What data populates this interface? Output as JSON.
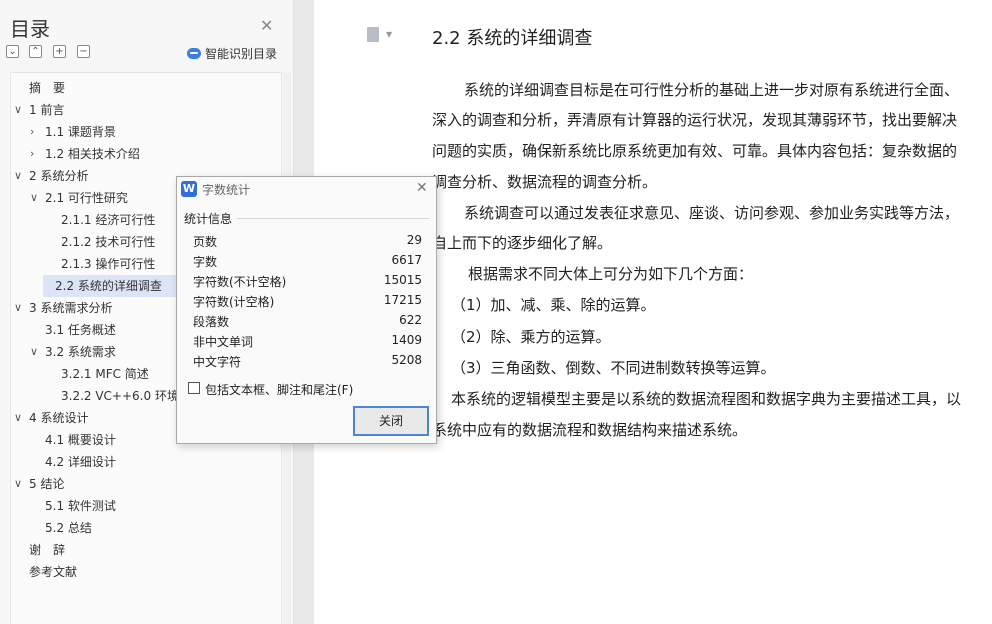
{
  "sidebar": {
    "title": "目录",
    "smart_toc_label": "智能识别目录",
    "tools": [
      "expand-all",
      "collapse",
      "add",
      "remove"
    ],
    "items": [
      {
        "label": "摘　要",
        "level": 0,
        "chevron": ""
      },
      {
        "label": "1 前言",
        "level": 0,
        "chevron": "v"
      },
      {
        "label": "1.1 课题背景",
        "level": 1,
        "chevron": ">"
      },
      {
        "label": "1.2 相关技术介绍",
        "level": 1,
        "chevron": ">"
      },
      {
        "label": "2 系统分析",
        "level": 0,
        "chevron": "v"
      },
      {
        "label": "2.1 可行性研究",
        "level": 1,
        "chevron": "v"
      },
      {
        "label": "2.1.1 经济可行性",
        "level": 2,
        "chevron": ""
      },
      {
        "label": "2.1.2 技术可行性",
        "level": 2,
        "chevron": ""
      },
      {
        "label": "2.1.3 操作可行性",
        "level": 2,
        "chevron": ""
      },
      {
        "label": "2.2 系统的详细调查",
        "level": 1,
        "chevron": "",
        "selected": true
      },
      {
        "label": "3 系统需求分析",
        "level": 0,
        "chevron": "v"
      },
      {
        "label": "3.1  任务概述",
        "level": 1,
        "chevron": ""
      },
      {
        "label": "3.2  系统需求",
        "level": 1,
        "chevron": "v"
      },
      {
        "label": "3.2.1 MFC 简述",
        "level": 2,
        "chevron": ""
      },
      {
        "label": "3.2.2   VC++6.0 环境",
        "level": 2,
        "chevron": ""
      },
      {
        "label": "4 系统设计",
        "level": 0,
        "chevron": "v"
      },
      {
        "label": "4.1  概要设计",
        "level": 1,
        "chevron": ""
      },
      {
        "label": "4.2 详细设计",
        "level": 1,
        "chevron": ""
      },
      {
        "label": "5 结论",
        "level": 0,
        "chevron": "v"
      },
      {
        "label": "5.1 软件测试",
        "level": 1,
        "chevron": ""
      },
      {
        "label": "5.2 总结",
        "level": 1,
        "chevron": ""
      },
      {
        "label": "谢　辞",
        "level": 0,
        "chevron": ""
      },
      {
        "label": "参考文献",
        "level": 0,
        "chevron": ""
      }
    ]
  },
  "document": {
    "heading": "2.2 系统的详细调查",
    "lines": [
      "系统的详细调查目标是在可行性分析的基础上进一步对原有系统进行全面、",
      "深入的调查和分析，弄清原有计算器的运行状况，发现其薄弱环节，找出要解决",
      "问题的实质，确保新系统比原系统更加有效、可靠。具体内容包括：复杂数据的",
      "调查分析、数据流程的调查分析。",
      "系统调查可以通过发表征求意见、座谈、访问参观、参加业务实践等方法，",
      "自上而下的逐步细化了解。",
      "根据需求不同大体上可分为如下几个方面：",
      "（1）加、减、乘、除的运算。",
      "（2）除、乘方的运算。",
      "（3）三角函数、倒数、不同进制数转换等运算。",
      "本系统的逻辑模型主要是以系统的数据流程图和数据字典为主要描述工具，以",
      "系统中应有的数据流程和数据结构来描述系统。"
    ]
  },
  "dialog": {
    "title": "字数统计",
    "section": "统计信息",
    "stats": [
      {
        "label": "页数",
        "value": "29"
      },
      {
        "label": "字数",
        "value": "6617"
      },
      {
        "label": "字符数(不计空格)",
        "value": "15015"
      },
      {
        "label": "字符数(计空格)",
        "value": "17215"
      },
      {
        "label": "段落数",
        "value": "622"
      },
      {
        "label": "非中文单词",
        "value": "1409"
      },
      {
        "label": "中文字符",
        "value": "5208"
      }
    ],
    "checkbox_label": "包括文本框、脚注和尾注(F)",
    "checkbox_checked": false,
    "close_button": "关闭"
  },
  "colors": {
    "accent": "#2f6fd8",
    "selected_bg": "#dbe5f7"
  }
}
